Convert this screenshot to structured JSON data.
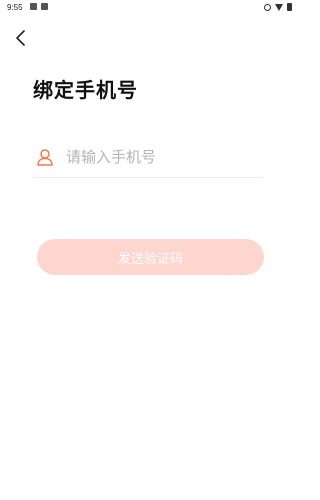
{
  "status_bar": {
    "time": "9:55",
    "left_icons": [
      "image-icon",
      "text-a-icon"
    ],
    "right_icons": [
      "dnd-icon",
      "wifi-icon",
      "battery-icon"
    ]
  },
  "header": {
    "back_icon": "chevron-left-icon"
  },
  "page": {
    "title": "绑定手机号"
  },
  "phone_field": {
    "icon": "user-icon",
    "placeholder": "请输入手机号",
    "value": ""
  },
  "send_code_button": {
    "label": "发送验证码"
  },
  "colors": {
    "accent_icon": "#f07a4e",
    "button_bg_disabled": "#ffd6cf",
    "placeholder": "#b4b4b4",
    "divider": "#ededed"
  }
}
